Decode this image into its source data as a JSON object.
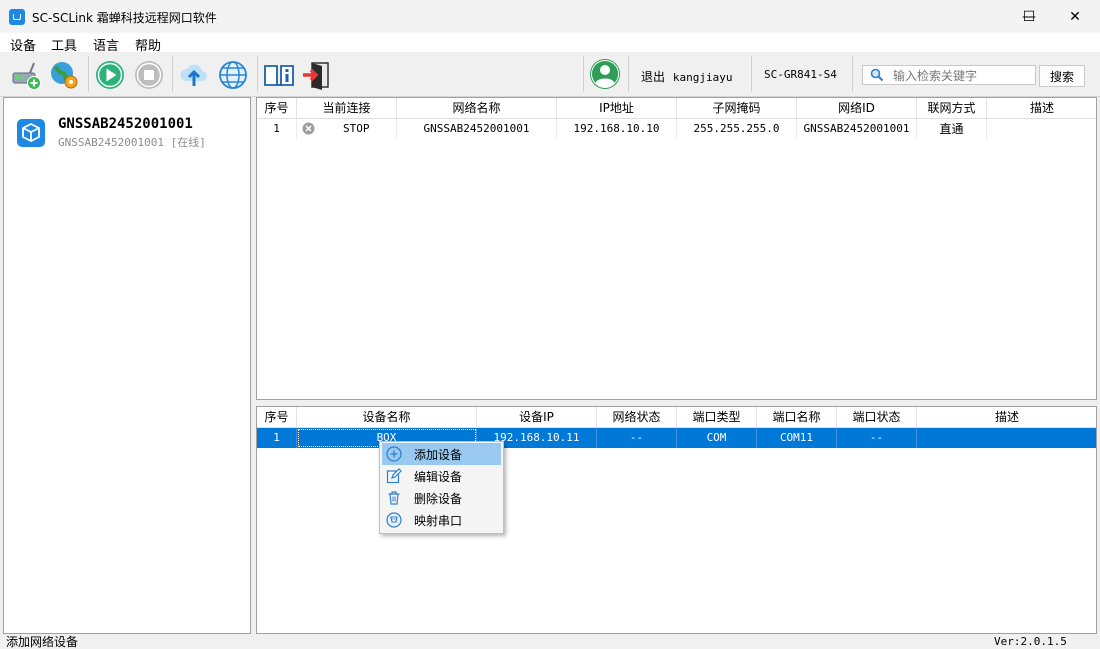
{
  "window": {
    "title": "SC-SCLink 霜蝉科技远程网口软件",
    "min": "—",
    "max": "☐",
    "close": "✕"
  },
  "menu": [
    "设备",
    "工具",
    "语言",
    "帮助"
  ],
  "toolbar": {
    "buttons": [
      "add-network-device",
      "network-settings",
      "start",
      "stop",
      "upload",
      "web",
      "manual",
      "exit"
    ],
    "logout_label": "退出",
    "username": "kangjiayu",
    "model": "SC-GR841-S4",
    "search_placeholder": "输入检索关键字",
    "search_button": "搜索"
  },
  "device_list": [
    {
      "name": "GNSSAB2452001001",
      "subtitle": "GNSSAB2452001001 [在线]"
    }
  ],
  "network_table": {
    "columns": [
      "序号",
      "当前连接",
      "网络名称",
      "IP地址",
      "子网掩码",
      "网络ID",
      "联网方式",
      "描述"
    ],
    "rows": [
      {
        "index": "1",
        "connection": "STOP",
        "name": "GNSSAB2452001001",
        "ip": "192.168.10.10",
        "mask": "255.255.255.0",
        "net_id": "GNSSAB2452001001",
        "mode": "直通",
        "desc": ""
      }
    ]
  },
  "device_table": {
    "columns": [
      "序号",
      "设备名称",
      "设备IP",
      "网络状态",
      "端口类型",
      "端口名称",
      "端口状态",
      "描述"
    ],
    "rows": [
      {
        "index": "1",
        "name": "BOX",
        "ip": "192.168.10.11",
        "net_status": "--",
        "port_type": "COM",
        "port_name": "COM11",
        "port_status": "--",
        "desc": ""
      }
    ]
  },
  "context_menu": {
    "items": [
      {
        "label": "添加设备",
        "icon": "plus-circle-icon"
      },
      {
        "label": "编辑设备",
        "icon": "edit-icon"
      },
      {
        "label": "删除设备",
        "icon": "trash-icon"
      },
      {
        "label": "映射串口",
        "icon": "serial-port-icon"
      }
    ],
    "highlighted_index": 0
  },
  "status": {
    "left": "添加网络设备",
    "right": "Ver:2.0.1.5"
  },
  "colors": {
    "selection": "#0078d7",
    "menu_highlight": "#99c9f1",
    "accent_green": "#2db37a",
    "stop_red": "#d32f2f"
  }
}
